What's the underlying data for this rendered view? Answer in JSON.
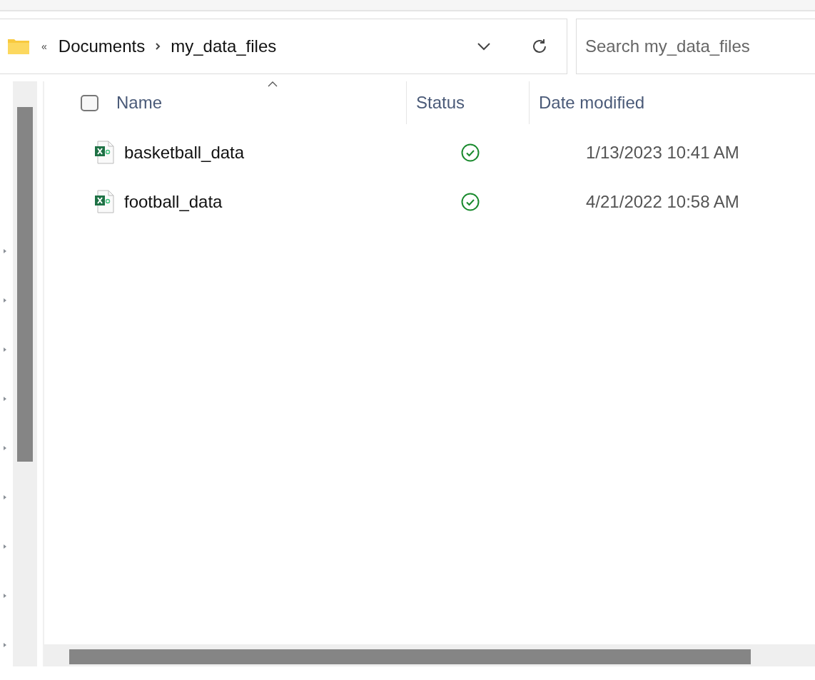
{
  "address_bar": {
    "overflow": "«",
    "path": [
      "Documents",
      "my_data_files"
    ]
  },
  "search": {
    "placeholder": "Search my_data_files"
  },
  "nav_tree": [
    {
      "expanded": false
    },
    {
      "expanded": false
    },
    {
      "expanded": false
    },
    {
      "expanded": false
    },
    {
      "expanded": false
    },
    {
      "expanded": false
    },
    {
      "expanded": false
    },
    {
      "expanded": false
    },
    {
      "expanded": false
    }
  ],
  "file_list": {
    "select_all": {
      "checked": false
    },
    "columns": [
      {
        "label": "Name",
        "sorted": true
      },
      {
        "label": "Status",
        "sorted": false
      },
      {
        "label": "Date modified",
        "sorted": false
      }
    ],
    "rows": [
      {
        "kind": "spreadsheet",
        "name": "basketball_data",
        "synced": true,
        "date_modified": "1/13/2023 10:41 AM"
      },
      {
        "kind": "spreadsheet",
        "name": "football_data",
        "synced": true,
        "date_modified": "4/21/2022 10:58 AM"
      }
    ]
  }
}
